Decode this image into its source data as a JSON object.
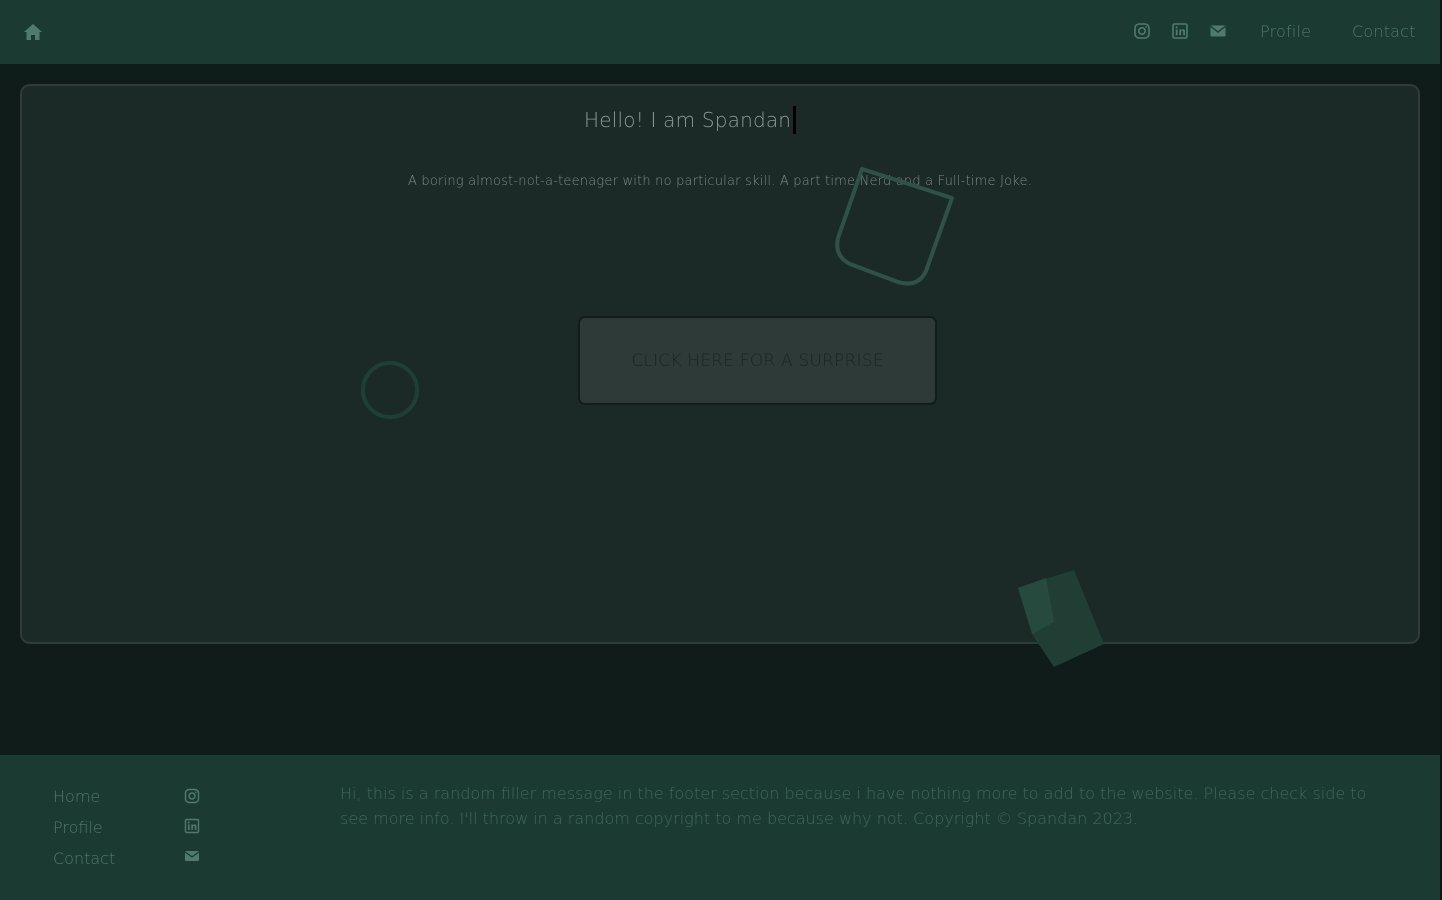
{
  "colors": {
    "nav_bg": "#1b3a32",
    "page_bg": "#0f1c19",
    "card_bg": "#1b2a27",
    "accent": "#4f7a6e",
    "button_bg": "#2d3a38"
  },
  "nav": {
    "home_icon": "home-icon",
    "social_icons": [
      "instagram-icon",
      "linkedin-icon",
      "envelope-icon"
    ],
    "links": [
      "Profile",
      "Contact"
    ]
  },
  "hero": {
    "greeting": "Hello! I am Spandan",
    "tagline": "A boring almost-not-a-teenager with no particular skill. A part time Nerd and a Full-time Joke.",
    "button_label": "CLICK HERE FOR A SURPRISE"
  },
  "footer": {
    "links": [
      "Home",
      "Profile",
      "Contact"
    ],
    "icons": [
      "instagram-icon",
      "linkedin-icon",
      "envelope-icon"
    ],
    "message": "Hi, this is a random filler message in the footer section because i have nothing more to add to the website. Please check side to see more info. I'll throw in a random copyright to me because why not. Copyright © Spandan 2023."
  }
}
